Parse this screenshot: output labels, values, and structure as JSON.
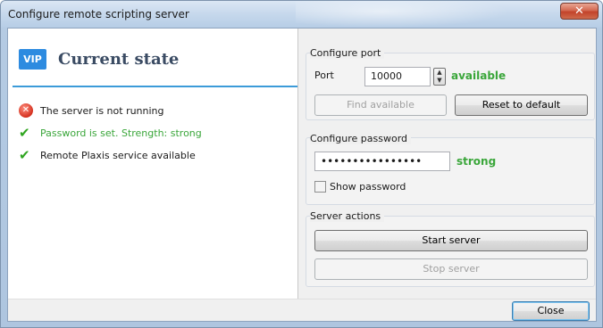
{
  "window": {
    "title": "Configure remote scripting server",
    "close_glyph": "✕"
  },
  "state": {
    "logo_text": "VIP",
    "title": "Current state",
    "items": [
      {
        "text": "The server is not running",
        "icon": "error-icon"
      },
      {
        "text": "Password is set. Strength: strong",
        "icon": "checkmark-icon"
      },
      {
        "text": "Remote Plaxis service available",
        "icon": "checkmark-icon"
      }
    ]
  },
  "port": {
    "group_title": "Configure port",
    "label": "Port",
    "value": "10000",
    "status": "available",
    "find_label": "Find available",
    "reset_label": "Reset to default"
  },
  "password": {
    "group_title": "Configure password",
    "value": "••••••••••••••••",
    "strength": "strong",
    "show_label": "Show password"
  },
  "actions": {
    "group_title": "Server actions",
    "start_label": "Start server",
    "stop_label": "Stop server"
  },
  "footer": {
    "close_label": "Close"
  },
  "colors": {
    "accent_line": "#3c9bd9",
    "ok_green": "#3aa63a",
    "error_red": "#d4311f"
  }
}
